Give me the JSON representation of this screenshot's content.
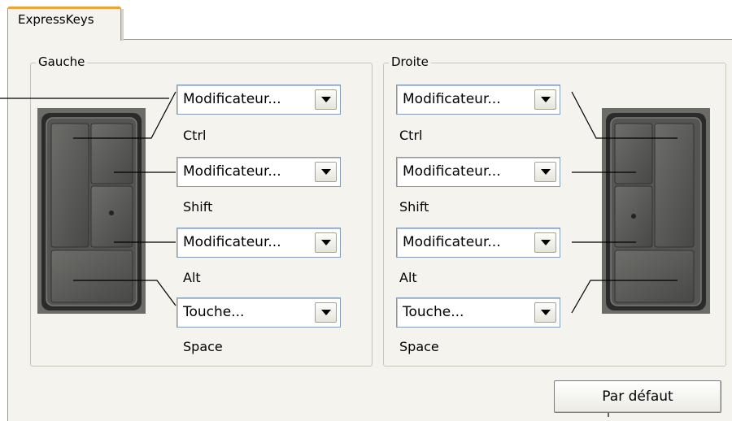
{
  "tabs": [
    {
      "label": "ExpressKeys"
    }
  ],
  "left_group": {
    "title": "Gauche",
    "keys": [
      {
        "select_value": "Modificateur...",
        "assigned": "Ctrl"
      },
      {
        "select_value": "Modificateur...",
        "assigned": "Shift"
      },
      {
        "select_value": "Modificateur...",
        "assigned": "Alt"
      },
      {
        "select_value": "Touche...",
        "assigned": "Space"
      }
    ]
  },
  "right_group": {
    "title": "Droite",
    "keys": [
      {
        "select_value": "Modificateur...",
        "assigned": "Ctrl"
      },
      {
        "select_value": "Modificateur...",
        "assigned": "Shift"
      },
      {
        "select_value": "Modificateur...",
        "assigned": "Alt"
      },
      {
        "select_value": "Touche...",
        "assigned": "Space"
      }
    ]
  },
  "default_button": {
    "label": "Par défaut"
  }
}
